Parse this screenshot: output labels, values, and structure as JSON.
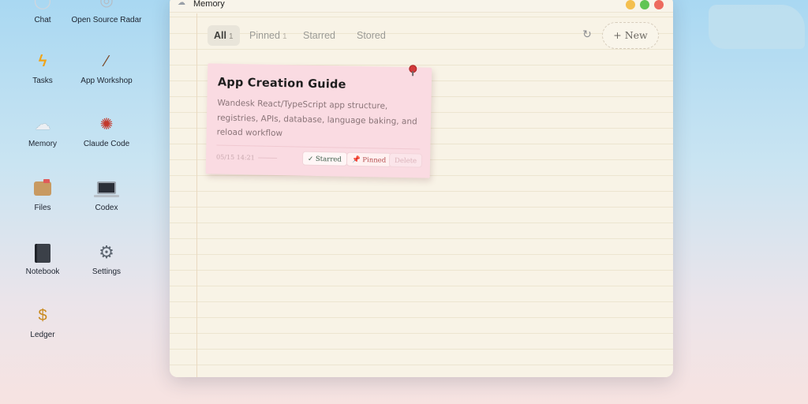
{
  "desktop": {
    "icons": [
      {
        "label": "Chat",
        "icon": "chat-bubble-icon"
      },
      {
        "label": "Open Source Radar",
        "icon": "radar-icon"
      },
      {
        "label": "Tasks",
        "icon": "lightning-bolt-icon"
      },
      {
        "label": "App Workshop",
        "icon": "magic-wand-icon"
      },
      {
        "label": "Memory",
        "icon": "thought-cloud-icon"
      },
      {
        "label": "Claude Code",
        "icon": "octopus-icon"
      },
      {
        "label": "Files",
        "icon": "file-box-icon"
      },
      {
        "label": "Codex",
        "icon": "laptop-icon"
      },
      {
        "label": "Notebook",
        "icon": "notebook-icon"
      },
      {
        "label": "Settings",
        "icon": "gear-icon"
      },
      {
        "label": "Ledger",
        "icon": "money-bag-icon"
      }
    ]
  },
  "window": {
    "title": "Memory",
    "icon": "thought-cloud-icon"
  },
  "tabs": [
    {
      "label": "All",
      "count": "1",
      "active": true
    },
    {
      "label": "Pinned",
      "count": "1",
      "active": false
    },
    {
      "label": "Starred",
      "count": "",
      "active": false
    },
    {
      "label": "Stored",
      "count": "",
      "active": false
    }
  ],
  "toolbar": {
    "refresh_icon": "refresh-icon",
    "new_label": "+ New"
  },
  "notes": [
    {
      "title": "App Creation Guide",
      "body": "Wandesk React/TypeScript app structure, registries, APIs, database, language baking, and reload workflow",
      "date": "05/15 14:21",
      "starred_label": "✓ Starred",
      "pinned_label": "📌 Pinned",
      "delete_label": "Delete"
    }
  ],
  "colors": {
    "paper": "#f8f3e6",
    "note": "#fadbe2",
    "pin": "#d23a3a"
  }
}
